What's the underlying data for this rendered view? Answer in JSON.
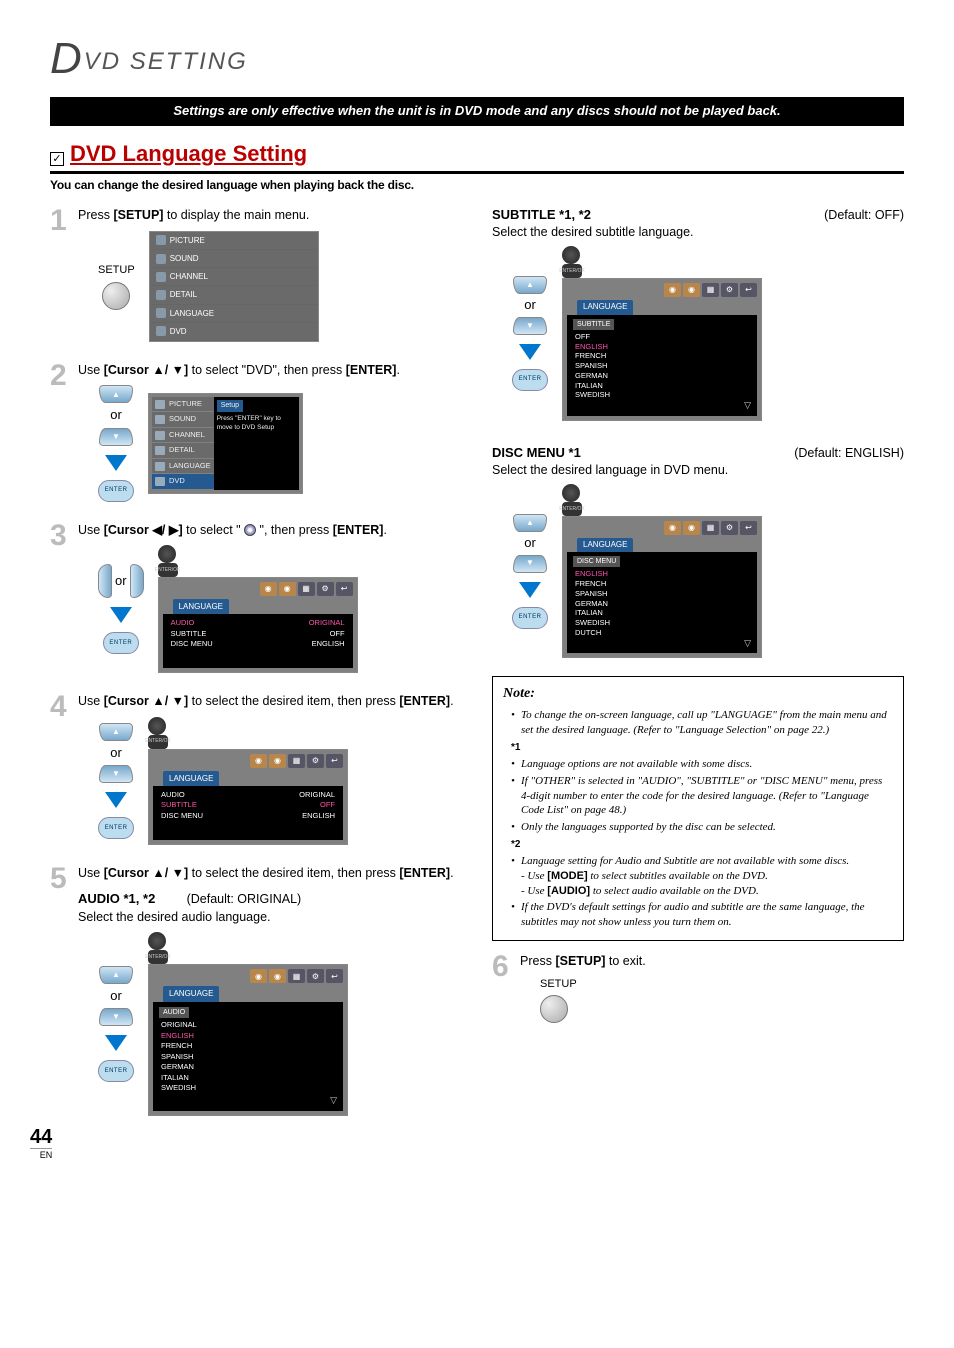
{
  "header": {
    "big_letter": "D",
    "rest": "VD  SETTING"
  },
  "black_bar": "Settings are only effective when the unit is in DVD mode and any discs should not be played back.",
  "section": {
    "checkbox_glyph": "✓",
    "title": "DVD Language Setting",
    "subtitle": "You can change the desired language when playing back the disc."
  },
  "steps": {
    "s1": {
      "num": "1",
      "pre": "Press ",
      "key": "[SETUP]",
      "post": " to display the main menu.",
      "setup_label": "SETUP"
    },
    "s2": {
      "num": "2",
      "pre": "Use ",
      "key": "[Cursor ▲/ ▼]",
      "mid": " to select \"DVD\", then press ",
      "key2": "[ENTER]",
      "post": "."
    },
    "s3": {
      "num": "3",
      "pre": "Use ",
      "key": "[Cursor ◀/ ▶]",
      "mid": " to select \" ",
      "mid2": " \", then press ",
      "key2": "[ENTER]",
      "post": "."
    },
    "s4": {
      "num": "4",
      "pre": "Use ",
      "key": "[Cursor ▲/ ▼]",
      "mid": " to select the desired item, then press ",
      "key2": "[ENTER]",
      "post": "."
    },
    "s5": {
      "num": "5",
      "pre": "Use ",
      "key": "[Cursor ▲/ ▼]",
      "mid": " to select the desired item, then press ",
      "key2": "[ENTER]",
      "post": "."
    },
    "s6": {
      "num": "6",
      "pre": "Press ",
      "key": "[SETUP]",
      "post": " to exit.",
      "setup_label": "SETUP"
    }
  },
  "remote": {
    "or": "or",
    "enter": "ENTER"
  },
  "menu": {
    "items": [
      "PICTURE",
      "SOUND",
      "CHANNEL",
      "DETAIL",
      "LANGUAGE",
      "DVD"
    ],
    "setup_title": "Setup",
    "setup_hint": "Press \"ENTER\" key to move to DVD Setup"
  },
  "osd": {
    "tab": "LANGUAGE",
    "row1_l": "AUDIO",
    "row1_r": "ORIGINAL",
    "row2_l": "SUBTITLE",
    "row2_r": "OFF",
    "row3_l": "DISC MENU",
    "row3_r": "ENGLISH",
    "navkey": "ENTER/OK",
    "more": "▽"
  },
  "sub_audio": {
    "label": "AUDIO *1, *2",
    "default": "(Default: ORIGINAL)",
    "desc": "Select the desired audio language.",
    "sub_head": "AUDIO",
    "opts": [
      "ORIGINAL",
      "ENGLISH",
      "FRENCH",
      "SPANISH",
      "GERMAN",
      "ITALIAN",
      "SWEDISH"
    ]
  },
  "sub_subtitle": {
    "label": "SUBTITLE *1, *2",
    "default": "(Default: OFF)",
    "desc": "Select the desired subtitle language.",
    "sub_head": "SUBTITLE",
    "opts": [
      "OFF",
      "ENGLISH",
      "FRENCH",
      "SPANISH",
      "GERMAN",
      "ITALIAN",
      "SWEDISH"
    ]
  },
  "sub_discmenu": {
    "label": "DISC MENU *1",
    "default": "(Default: ENGLISH)",
    "desc": "Select the desired language in DVD menu.",
    "sub_head": "DISC MENU",
    "opts": [
      "ENGLISH",
      "FRENCH",
      "SPANISH",
      "GERMAN",
      "ITALIAN",
      "SWEDISH",
      "DUTCH"
    ]
  },
  "note": {
    "title": "Note:",
    "l1": "To change the on-screen language, call up \"LANGUAGE\" from the main menu and set the desired language. (Refer to \"Language Selection\" on page 22.)",
    "ref1": "*1",
    "l2": "Language options are not available with some discs.",
    "l3": "If \"OTHER\" is selected in \"AUDIO\", \"SUBTITLE\" or \"DISC MENU\" menu, press 4-digit number to enter the code for the desired language. (Refer to \"Language Code List\" on page 48.)",
    "l4": "Only the languages supported by the disc can be selected.",
    "ref2": "*2",
    "l5": "Language setting for Audio and Subtitle are not available with some discs.",
    "l5a": "- Use ",
    "l5a_key": "[MODE]",
    "l5a_post": " to select subtitles available on the DVD.",
    "l5b": "- Use ",
    "l5b_key": "[AUDIO]",
    "l5b_post": " to select audio available on the DVD.",
    "l6": "If the DVD's default settings for audio and subtitle are the same language, the subtitles may not show unless you turn them on."
  },
  "page": {
    "num": "44",
    "lang": "EN"
  }
}
